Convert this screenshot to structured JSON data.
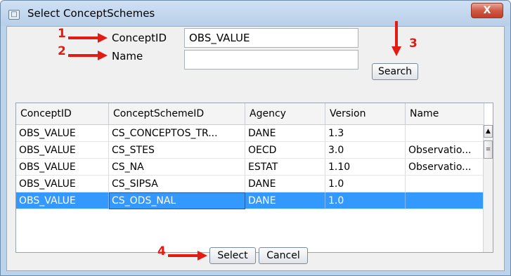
{
  "window": {
    "title": "Select ConceptSchemes",
    "close_label": "X",
    "app_icon": "window-icon",
    "close_icon": "close-icon"
  },
  "form": {
    "concept_id_label": "ConceptID",
    "concept_id_value": "OBS_VALUE",
    "name_label": "Name",
    "name_value": "",
    "search_label": "Search"
  },
  "table": {
    "columns": [
      "ConceptID",
      "ConceptSchemeID",
      "Agency",
      "Version",
      "Name"
    ],
    "rows": [
      [
        "OBS_VALUE",
        "CS_CONCEPTOS_TR...",
        "DANE",
        "1.3",
        ""
      ],
      [
        "OBS_VALUE",
        "CS_STES",
        "OECD",
        "3.0",
        "Observatio..."
      ],
      [
        "OBS_VALUE",
        "CS_NA",
        "ESTAT",
        "1.10",
        "Observatio..."
      ],
      [
        "OBS_VALUE",
        "CS_SIPSA",
        "DANE",
        "1.0",
        ""
      ],
      [
        "OBS_VALUE",
        "CS_ODS_NAL",
        "DANE",
        "1.0",
        ""
      ]
    ],
    "selected_row": 4
  },
  "footer": {
    "select_label": "Select",
    "cancel_label": "Cancel"
  },
  "annotations": {
    "a1": "1",
    "a2": "2",
    "a3": "3",
    "a4": "4",
    "color": "#e31b12"
  },
  "colors": {
    "selection": "#3399ff",
    "titlebar": "#bcd3ec",
    "close": "#c9503b"
  }
}
